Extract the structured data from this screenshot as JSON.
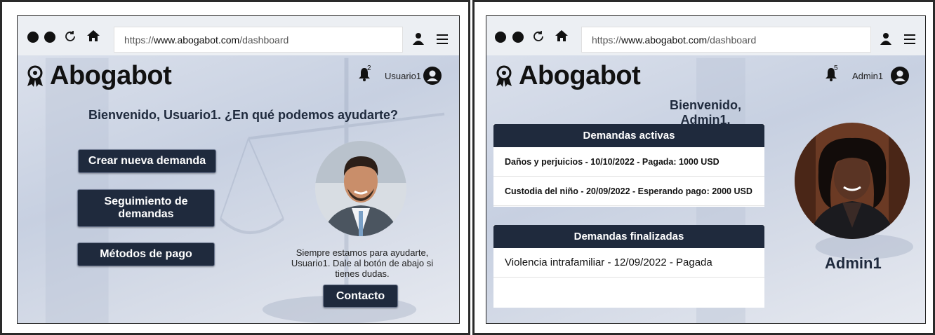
{
  "left": {
    "browser": {
      "url_prefix": "https://",
      "url_host": "www.abogabot.com",
      "url_path": "/dashboard"
    },
    "brand": {
      "name": "Abogabot"
    },
    "notifications": {
      "count": "2"
    },
    "user": {
      "label": "Usuario1"
    },
    "heading": "Bienvenido, Usuario1. ¿En qué podemos ayudarte?",
    "buttons": {
      "new_claim": "Crear nueva demanda",
      "tracking": "Seguimiento de demandas",
      "payment": "Métodos de pago",
      "contact": "Contacto"
    },
    "help_note": "Siempre estamos para ayudarte, Usuario1. Dale al botón de abajo si tienes dudas."
  },
  "right": {
    "browser": {
      "url_prefix": "https://",
      "url_host": "www.abogabot.com",
      "url_path": "/dashboard"
    },
    "brand": {
      "name": "Abogabot"
    },
    "notifications": {
      "count": "5"
    },
    "user": {
      "label": "Admin1"
    },
    "heading": "Bienvenido, Admin1.",
    "active_claims": {
      "title": "Demandas activas",
      "rows": [
        "Daños y perjuicios - 10/10/2022 - Pagada: 1000 USD",
        "Custodia del niño - 20/09/2022 - Esperando pago: 2000 USD"
      ]
    },
    "finished_claims": {
      "title": "Demandas finalizadas",
      "rows": [
        "Violencia intrafamiliar - 12/09/2022 - Pagada"
      ]
    },
    "profile_name": "Admin1"
  },
  "colors": {
    "navy": "#1f2a3d",
    "background": "#d5dbe7"
  }
}
